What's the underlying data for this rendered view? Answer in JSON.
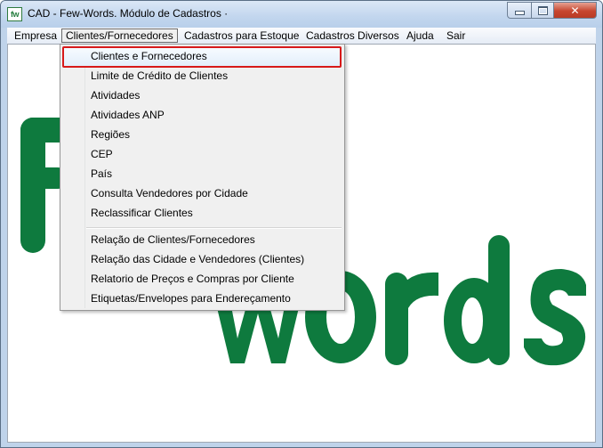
{
  "window": {
    "title": "CAD - Few-Words. Módulo de Cadastros ·",
    "icon_text": "fw",
    "close_symbol": "✕"
  },
  "menubar": {
    "items": [
      {
        "label": "Empresa"
      },
      {
        "label": "Clientes/Fornecedores",
        "active": true
      },
      {
        "label": "Cadastros para Estoque"
      },
      {
        "label": "Cadastros Diversos"
      },
      {
        "label": "Ajuda"
      },
      {
        "label": "Sair"
      }
    ]
  },
  "dropdown": {
    "items": [
      {
        "label": "Clientes e Fornecedores",
        "highlighted": true
      },
      {
        "label": "Limite de Crédito de Clientes"
      },
      {
        "label": "Atividades"
      },
      {
        "label": "Atividades ANP"
      },
      {
        "label": "Regiões"
      },
      {
        "label": "CEP"
      },
      {
        "label": "País"
      },
      {
        "label": "Consulta Vendedores por Cidade"
      },
      {
        "label": "Reclassificar Clientes"
      },
      {
        "label": "Relação de Clientes/Fornecedores"
      },
      {
        "label": "Relação das Cidade e Vendedores (Clientes)"
      },
      {
        "label": "Relatorio de Preços e Compras por Cliente"
      },
      {
        "label": "Etiquetas/Envelopes para Endereçamento"
      }
    ]
  },
  "colors": {
    "logo_green": "#0e7a3e",
    "highlight_border": "#d71a1a"
  }
}
